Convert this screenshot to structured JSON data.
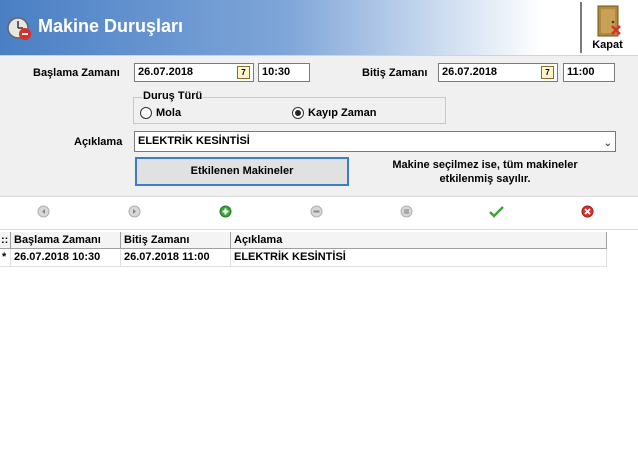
{
  "window": {
    "title": "Makine Duruşları",
    "close_label": "Kapat"
  },
  "form": {
    "start_label": "Başlama Zamanı",
    "start_date": "26.07.2018",
    "start_time": "10:30",
    "end_label": "Bitiş Zamanı",
    "end_date": "26.07.2018",
    "end_time": "11:00",
    "calendar_icon_text": "7",
    "stop_type_label": "Duruş Türü",
    "option_break": "Mola",
    "option_lost_time": "Kayıp Zaman",
    "selected_option": "Kayıp Zaman",
    "description_label": "Açıklama",
    "description_value": "ELEKTRİK KESİNTİSİ",
    "machines_button": "Etkilenen Makineler",
    "note_line1": "Makine seçilmez ise, tüm makineler",
    "note_line2": "etkilenmiş sayılır."
  },
  "toolbar": {
    "buttons": [
      "first-icon",
      "previous-icon",
      "add-icon",
      "remove-icon",
      "next-icon",
      "confirm-icon",
      "cancel-icon"
    ]
  },
  "grid": {
    "corner": "::",
    "row_marker": "*",
    "columns": [
      "Başlama Zamanı",
      "Bitiş Zamanı",
      "Açıklama"
    ],
    "rows": [
      [
        "26.07.2018 10:30",
        "26.07.2018 11:00",
        "ELEKTRİK KESİNTİSİ"
      ]
    ]
  },
  "colors": {
    "header_blue": "#4a7fc4",
    "focus_border": "#3b7dc8",
    "add_green": "#3aa53a",
    "cancel_red": "#d9302a"
  }
}
